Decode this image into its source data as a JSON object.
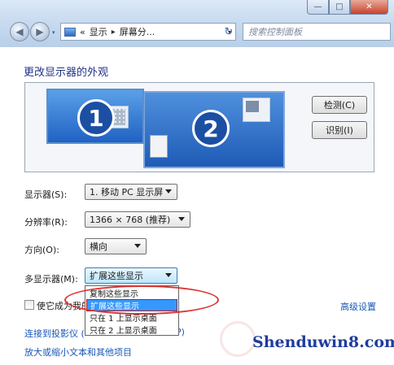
{
  "window_controls": {
    "minimize": "—",
    "maximize": "□",
    "close": "✕"
  },
  "nav": {
    "back_icon": "◀",
    "forward_icon": "▶",
    "recent_icon": "▾"
  },
  "address_bar": {
    "overflow": "«",
    "crumbs": [
      "显示",
      "屏幕分..."
    ],
    "separator": "▸",
    "dropdown_icon": "▾"
  },
  "refresh_icon": "↻",
  "search": {
    "placeholder": "搜索控制面板"
  },
  "page": {
    "title": "更改显示器的外观"
  },
  "monitors": {
    "one": "1",
    "two": "2"
  },
  "buttons": {
    "detect": "检测(C)",
    "identify": "识别(I)"
  },
  "fields": {
    "display": {
      "label": "显示器(S):",
      "value": "1. 移动 PC 显示屏"
    },
    "resolution": {
      "label": "分辨率(R):",
      "value": "1366 × 768 (推荐)"
    },
    "orientation": {
      "label": "方向(O):",
      "value": "横向"
    },
    "multiple_displays": {
      "label": "多显示器(M):",
      "value": "扩展这些显示",
      "options": [
        "复制这些显示",
        "扩展这些显示",
        "只在 1 上显示桌面",
        "只在 2 上显示桌面"
      ],
      "selected_index": 1
    }
  },
  "checkbox": {
    "label": "使它成为我的"
  },
  "links": {
    "advanced": "高级设置",
    "projector": "连接到投影仪 (",
    "projector_tail": "P)",
    "text_size": "放大或缩小文本和其他项目"
  },
  "watermark": "Shenduwin8.com",
  "colors": {
    "accent": "#1e3287",
    "link": "#1a57b8",
    "highlight": "#3399ff",
    "annotation": "#dd3333"
  }
}
